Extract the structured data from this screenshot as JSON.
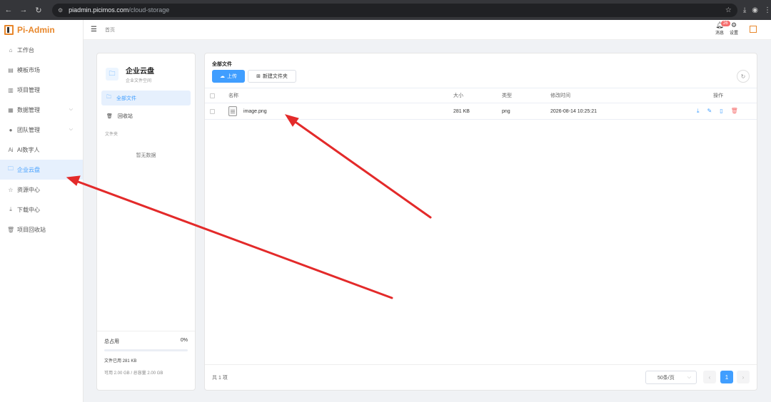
{
  "browser": {
    "url_host": "piadmin.picimos.com",
    "url_path": "/cloud-storage"
  },
  "app": {
    "name": "Pi-Admin"
  },
  "sidebar": {
    "items": [
      {
        "label": "工作台",
        "icon": "home-icon"
      },
      {
        "label": "模板市场",
        "icon": "template-icon"
      },
      {
        "label": "项目管理",
        "icon": "chart-icon"
      },
      {
        "label": "数据管理",
        "icon": "database-icon",
        "expandable": true
      },
      {
        "label": "团队管理",
        "icon": "user-icon",
        "expandable": true
      },
      {
        "label": "AI数字人",
        "icon": "ai-icon"
      },
      {
        "label": "企业云盘",
        "icon": "folder-icon",
        "active": true
      },
      {
        "label": "资源中心",
        "icon": "star-icon"
      },
      {
        "label": "下载中心",
        "icon": "download-icon"
      },
      {
        "label": "项目回收站",
        "icon": "trash-icon"
      }
    ]
  },
  "header": {
    "breadcrumb": "首页",
    "messages_label": "消息",
    "messages_badge": "26",
    "settings_label": "设置"
  },
  "cloud": {
    "title": "企业云盘",
    "subtitle": "企业文件空间",
    "nav": [
      {
        "label": "全部文件",
        "active": true
      },
      {
        "label": "回收站"
      }
    ],
    "folders_label": "文件夹",
    "empty_text": "暂无数据",
    "usage": {
      "total_label": "总占用",
      "percent": "0%",
      "fill_fraction": 0,
      "used_text": "文件已用 281 KB",
      "avail_text": "可用 2.00 GB / 总容量 2.00 GB"
    }
  },
  "files": {
    "title": "全部文件",
    "upload_label": "上传",
    "new_folder_label": "新建文件夹",
    "columns": {
      "name": "名称",
      "size": "大小",
      "type": "类型",
      "modified": "修改时间",
      "actions": "操作"
    },
    "rows": [
      {
        "name": "image.png",
        "size": "281 KB",
        "type": "png",
        "modified": "2026-08-14 10:25:21"
      }
    ],
    "total_text": "共 1 项",
    "page_size": "50条/页",
    "current_page": "1"
  },
  "colors": {
    "accent": "#409eff",
    "brand": "#e8872b",
    "danger": "#f56c6c",
    "annotation": "#e32a2a"
  }
}
